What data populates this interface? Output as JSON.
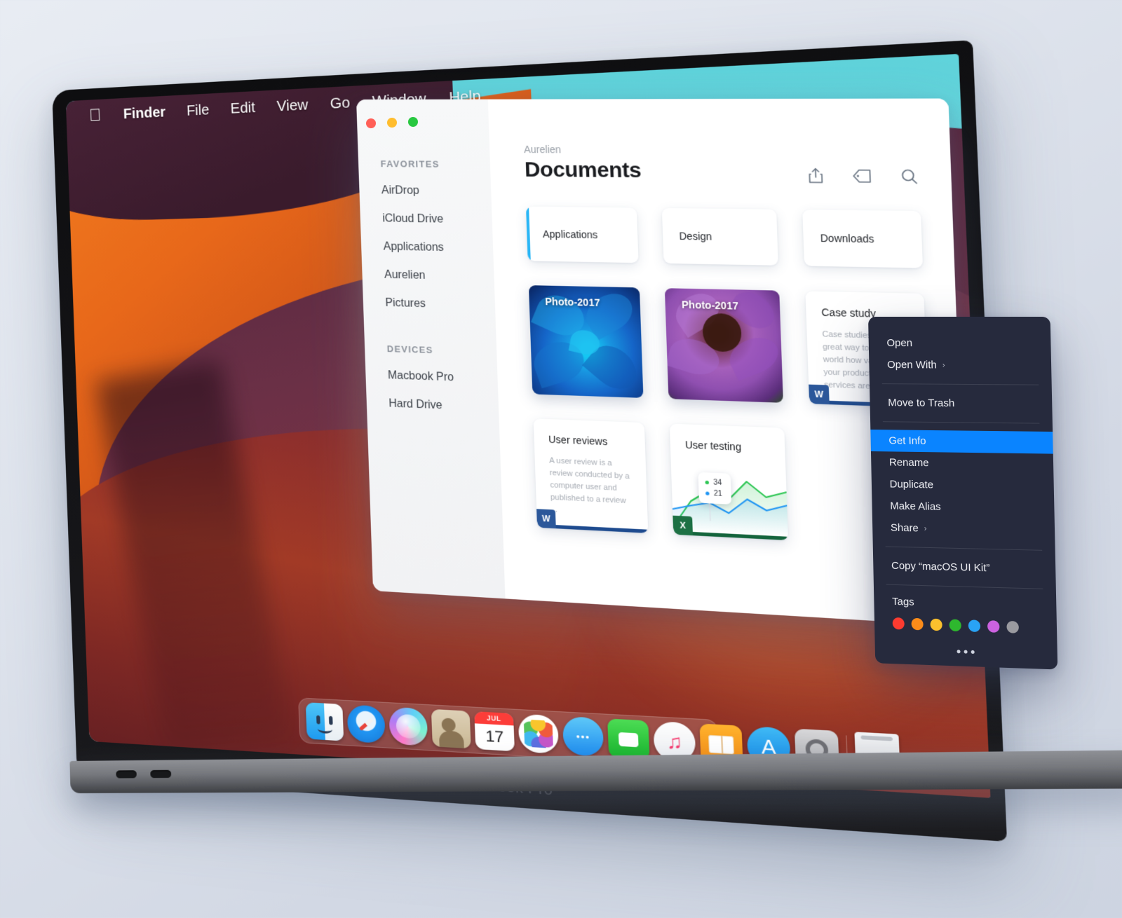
{
  "background_color": "#d3d9e4",
  "device": {
    "name": "MacBook Pro",
    "bezel_label": "MacBook Pro"
  },
  "menubar": {
    "apple_icon": "apple-icon",
    "items": [
      "Finder",
      "File",
      "Edit",
      "View",
      "Go",
      "Window",
      "Help"
    ]
  },
  "finder": {
    "traffic_lights": [
      {
        "name": "close",
        "color": "#ff5f57"
      },
      {
        "name": "minimize",
        "color": "#ffbd2e"
      },
      {
        "name": "zoom",
        "color": "#28c840"
      }
    ],
    "sidebar": {
      "sections": [
        {
          "title": "FAVORITES",
          "items": [
            "AirDrop",
            "iCloud Drive",
            "Applications",
            "Aurelien",
            "Pictures"
          ]
        },
        {
          "title": "DEVICES",
          "items": [
            "Macbook Pro",
            "Hard Drive"
          ]
        }
      ]
    },
    "breadcrumb": "Aurelien",
    "title": "Documents",
    "toolbar": [
      {
        "name": "share-icon",
        "label": "Share"
      },
      {
        "name": "tag-icon",
        "label": "Tag"
      },
      {
        "name": "search-icon",
        "label": "Search"
      }
    ],
    "folders": [
      {
        "label": "Applications",
        "selected": true,
        "accent": "#29b6f6"
      },
      {
        "label": "Design",
        "selected": false
      },
      {
        "label": "Downloads",
        "selected": false
      }
    ],
    "photos": [
      {
        "label": "Photo-2017",
        "variant": "blue-flower"
      },
      {
        "label": "Photo-2017",
        "variant": "purple-flower"
      }
    ],
    "documents": [
      {
        "title": "Case study",
        "body": "Case studies are a great way to tell the world how valuable your products or services are for ...",
        "badge": "W",
        "badge_color": "#2b579a",
        "type": "word"
      },
      {
        "title": "User reviews",
        "body": "A user review is a review conducted by a computer user and published to a review ...",
        "badge": "W",
        "badge_color": "#2b579a",
        "type": "word"
      },
      {
        "title": "User testing",
        "badge": "X",
        "badge_color": "#1d7044",
        "type": "excel"
      }
    ]
  },
  "chart_data": {
    "type": "line",
    "title": "User testing",
    "x": [
      0,
      1,
      2,
      3,
      4,
      5,
      6
    ],
    "series": [
      {
        "name": "green",
        "color": "#2dc653",
        "values": [
          2,
          18,
          26,
          21,
          34,
          24,
          27
        ]
      },
      {
        "name": "blue",
        "color": "#2196f3",
        "values": [
          10,
          14,
          17,
          12,
          21,
          15,
          18
        ]
      }
    ],
    "tooltip": [
      {
        "color": "#2dc653",
        "value": "34"
      },
      {
        "color": "#2196f3",
        "value": "21"
      }
    ],
    "grid": false,
    "legend": "none",
    "xlabel": "",
    "ylabel": ""
  },
  "context_menu": {
    "groups": [
      [
        "Open",
        "Open With"
      ],
      [
        "Move to Trash"
      ],
      [
        "Get Info",
        "Rename",
        "Duplicate",
        "Make Alias",
        "Share"
      ],
      [
        "Copy “macOS UI Kit”"
      ]
    ],
    "items": [
      {
        "label": "Open",
        "submenu": false,
        "highlighted": false
      },
      {
        "label": "Open With",
        "submenu": true,
        "highlighted": false
      },
      {
        "label": "Move to Trash",
        "submenu": false,
        "highlighted": false
      },
      {
        "label": "Get Info",
        "submenu": false,
        "highlighted": true
      },
      {
        "label": "Rename",
        "submenu": false,
        "highlighted": false
      },
      {
        "label": "Duplicate",
        "submenu": false,
        "highlighted": false
      },
      {
        "label": "Make Alias",
        "submenu": false,
        "highlighted": false
      },
      {
        "label": "Share",
        "submenu": true,
        "highlighted": false
      },
      {
        "label": "Copy “macOS UI Kit”",
        "submenu": false,
        "highlighted": false
      }
    ],
    "submenu_glyph": "›",
    "highlight_color": "#0a84ff",
    "tags_label": "Tags",
    "tag_colors": [
      "#fc3b30",
      "#fc8c1a",
      "#fbc02d",
      "#2eb82e",
      "#29a3f5",
      "#cc62e0",
      "#9a9aa0"
    ],
    "more_glyph": "•••"
  },
  "dock": {
    "items": [
      {
        "name": "finder-icon",
        "label": "Finder"
      },
      {
        "name": "safari-icon",
        "label": "Safari"
      },
      {
        "name": "siri-icon",
        "label": "Siri"
      },
      {
        "name": "contacts-icon",
        "label": "Contacts"
      },
      {
        "name": "calendar-icon",
        "label": "Calendar",
        "month": "JUL",
        "day": "17"
      },
      {
        "name": "photos-icon",
        "label": "Photos"
      },
      {
        "name": "messages-icon",
        "label": "Messages"
      },
      {
        "name": "facetime-icon",
        "label": "FaceTime"
      },
      {
        "name": "itunes-icon",
        "label": "iTunes"
      },
      {
        "name": "books-icon",
        "label": "Books"
      },
      {
        "name": "appstore-icon",
        "label": "App Store"
      },
      {
        "name": "system-preferences-icon",
        "label": "System Preferences"
      },
      {
        "name": "trash-icon",
        "label": "Trash"
      }
    ]
  }
}
